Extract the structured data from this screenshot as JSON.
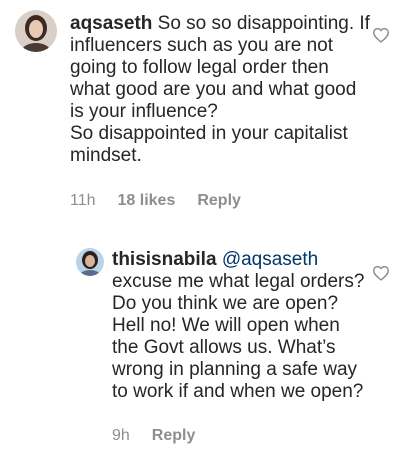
{
  "comments": [
    {
      "username": "aqsaseth",
      "text_main": "So so so disappointing. If influencers such as you are not going to follow legal order then what good are you and what good is your influence?",
      "text_second": "So disappointed in your capitalist mindset.",
      "time": "11h",
      "likes": "18 likes",
      "reply_label": "Reply",
      "avatar_icon": "profile-photo",
      "like_icon": "heart-outline-icon"
    },
    {
      "username": "thisisnabila",
      "mention": "@aqsaseth",
      "text_main": "excuse me what legal orders? Do you think we are open? Hell no! We will open when the Govt allows us. What’s wrong in planning a safe way to work if and when we open?",
      "time": "9h",
      "reply_label": "Reply",
      "avatar_icon": "profile-photo",
      "like_icon": "heart-outline-icon"
    }
  ],
  "colors": {
    "text": "#262626",
    "meta": "#8e8e8e",
    "mention": "#00376b"
  }
}
